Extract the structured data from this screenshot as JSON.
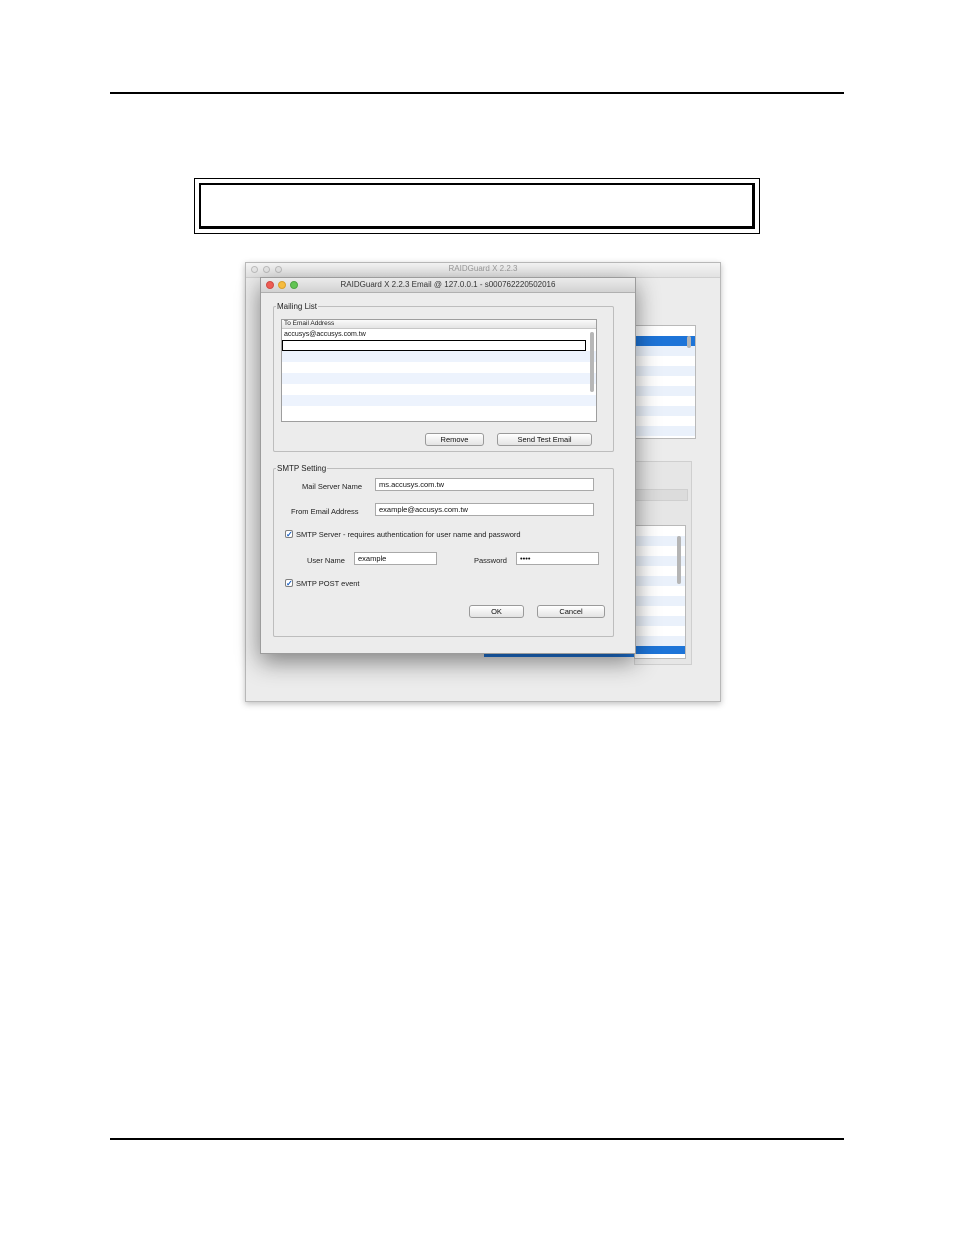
{
  "background_window": {
    "title": "RAIDGuard X 2.2.3"
  },
  "dialog": {
    "title": "RAIDGuard X 2.2.3 Email @ 127.0.0.1 - s000762220502016",
    "mailing_list": {
      "legend": "Mailing List",
      "column_header": "To Email Address",
      "entries": [
        "accusys@accusys.com.tw",
        ""
      ],
      "remove_label": "Remove",
      "send_test_label": "Send Test Email"
    },
    "smtp": {
      "legend": "SMTP Setting",
      "mail_server_label": "Mail Server Name",
      "mail_server_value": "ms.accusys.com.tw",
      "from_label": "From Email Address",
      "from_value": "example@accusys.com.tw",
      "auth_checkbox_label": "SMTP Server - requires authentication for user name and password",
      "auth_checked": true,
      "username_label": "User Name",
      "username_value": "example",
      "password_label": "Password",
      "password_value": "••••",
      "post_event_label": "SMTP POST event",
      "post_event_checked": true,
      "ok_label": "OK",
      "cancel_label": "Cancel"
    }
  },
  "colors": {
    "selection_blue": "#1d74d8",
    "row_alt": "#edf3fd",
    "traffic_red": "#ee5c54",
    "traffic_yellow": "#f6bc3e",
    "traffic_green": "#62c454"
  }
}
